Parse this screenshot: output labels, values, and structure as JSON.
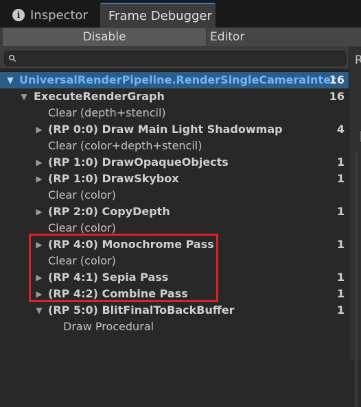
{
  "tabs": {
    "inspector": "Inspector",
    "frame_debugger": "Frame Debugger"
  },
  "toolbar": {
    "disable_label": "Disable",
    "editor_label": "Editor"
  },
  "search": {
    "placeholder": "",
    "value": ""
  },
  "right_panel": {
    "letter": "R"
  },
  "tree": {
    "root": {
      "label": "UniversalRenderPipeline.RenderSingleCameraInter",
      "count": "16"
    },
    "items": [
      {
        "label": "ExecuteRenderGraph",
        "count": "16"
      },
      {
        "label": "Clear (depth+stencil)",
        "count": ""
      },
      {
        "label": "(RP 0:0) Draw Main Light Shadowmap",
        "count": "4"
      },
      {
        "label": "Clear (color+depth+stencil)",
        "count": ""
      },
      {
        "label": "(RP 1:0) DrawOpaqueObjects",
        "count": "1"
      },
      {
        "label": "(RP 1:0) DrawSkybox",
        "count": "1"
      },
      {
        "label": "Clear (color)",
        "count": ""
      },
      {
        "label": "(RP 2:0) CopyDepth",
        "count": "1"
      },
      {
        "label": "Clear (color)",
        "count": ""
      },
      {
        "label": "(RP 4:0) Monochrome Pass",
        "count": "1"
      },
      {
        "label": "Clear (color)",
        "count": ""
      },
      {
        "label": "(RP 4:1) Sepia Pass",
        "count": "1"
      },
      {
        "label": "(RP 4:2) Combine Pass",
        "count": "1"
      },
      {
        "label": "(RP 5:0) BlitFinalToBackBuffer",
        "count": "1"
      },
      {
        "label": "Draw Procedural",
        "count": ""
      }
    ]
  },
  "colors": {
    "selection": "#2c5d87",
    "selection_text": "#6cb6ff",
    "highlight": "#e0212b",
    "tab_accent": "#3a79bb"
  }
}
